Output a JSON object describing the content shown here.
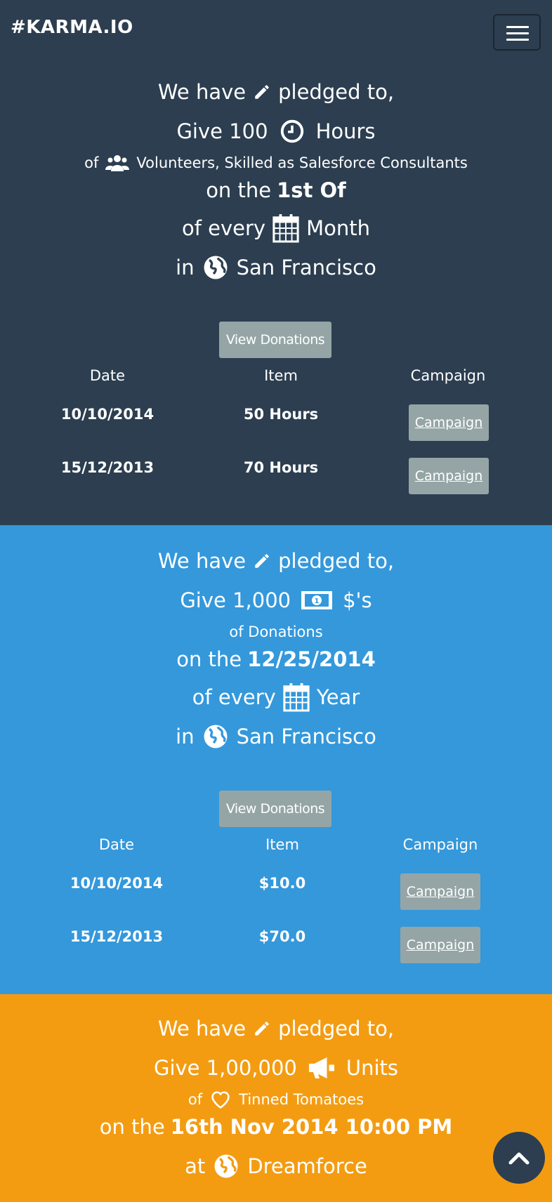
{
  "navbar": {
    "brand": "#KARMA.IO",
    "menu_icon": "hamburger-icon"
  },
  "pledges": [
    {
      "bg_color": "#2c3e50",
      "line1": "We have",
      "line1_after": "pledged to,",
      "give_prefix": "Give 100",
      "give_unit": "Hours",
      "of_prefix": "of",
      "of_text": "Volunteers, Skilled as Salesforce Consultants",
      "on_the": "on the",
      "on_date": "1st Of",
      "every_prefix": "of every",
      "every_unit": "Month",
      "in_prefix": "in",
      "location": "San Francisco",
      "view_button": "View Donations",
      "table": {
        "headers": [
          "Date",
          "Item",
          "Campaign"
        ],
        "rows": [
          {
            "date": "10/10/2014",
            "item": "50 Hours",
            "campaign": "Campaign"
          },
          {
            "date": "15/12/2013",
            "item": "70 Hours",
            "campaign": "Campaign"
          }
        ]
      }
    },
    {
      "bg_color": "#3498db",
      "line1": "We have",
      "line1_after": "pledged to,",
      "give_prefix": "Give 1,000",
      "give_unit": "$'s",
      "of_text": "of Donations",
      "on_the": "on the",
      "on_date": "12/25/2014",
      "every_prefix": "of every",
      "every_unit": "Year",
      "in_prefix": "in",
      "location": "San Francisco",
      "view_button": "View Donations",
      "table": {
        "headers": [
          "Date",
          "Item",
          "Campaign"
        ],
        "rows": [
          {
            "date": "10/10/2014",
            "item": "$10.0",
            "campaign": "Campaign"
          },
          {
            "date": "15/12/2013",
            "item": "$70.0",
            "campaign": "Campaign"
          }
        ]
      }
    },
    {
      "bg_color": "#f39c12",
      "line1": "We have",
      "line1_after": "pledged to,",
      "give_prefix": "Give 1,00,000",
      "give_unit": "Units",
      "of_prefix": "of",
      "of_text": "Tinned Tomatoes",
      "on_the": "on the",
      "on_date": "16th Nov 2014 10:00 PM",
      "at_prefix": "at",
      "location": "Dreamforce"
    }
  ],
  "scroll_top_icon": "chevron-up-icon"
}
